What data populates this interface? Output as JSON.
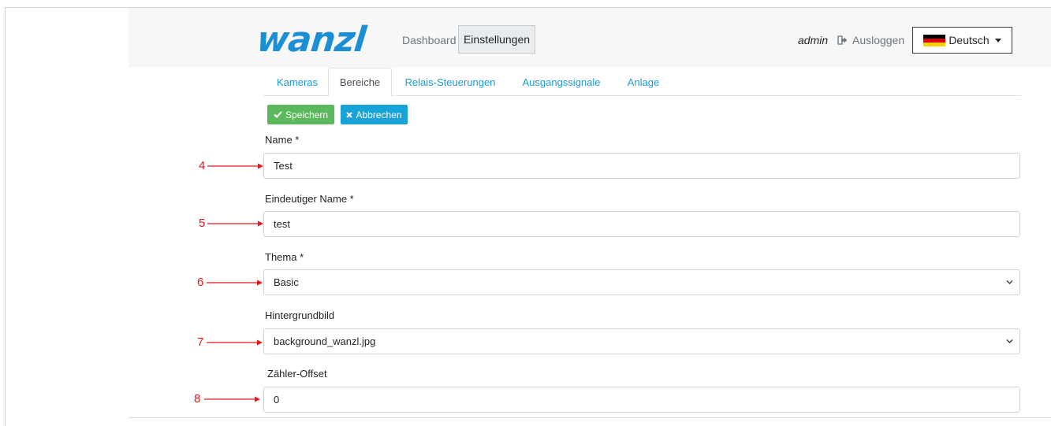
{
  "header": {
    "logo_text": "wanzl",
    "nav_dashboard": "Dashboard",
    "nav_settings": "Einstellungen",
    "user": "admin",
    "logout": "Ausloggen",
    "language": "Deutsch"
  },
  "tabs": [
    "Kameras",
    "Bereiche",
    "Relais-Steuerungen",
    "Ausgangssignale",
    "Anlage"
  ],
  "active_tab": "Bereiche",
  "actions": {
    "save": "Speichern",
    "cancel": "Abbrechen"
  },
  "form": {
    "name_label": "Name *",
    "name_value": "Test",
    "unique_label": "Eindeutiger Name *",
    "unique_value": "test",
    "theme_label": "Thema *",
    "theme_value": "Basic",
    "background_label": "Hintergrundbild",
    "background_value": "background_wanzl.jpg",
    "offset_label": "Zähler-Offset",
    "offset_value": "0"
  },
  "annotations": [
    "4",
    "5",
    "6",
    "7",
    "8"
  ],
  "colors": {
    "brand": "#1b8fd6",
    "link": "#1a9bd7",
    "success": "#5cb85c",
    "info": "#17a2d8",
    "annotation": "#e8141a"
  }
}
